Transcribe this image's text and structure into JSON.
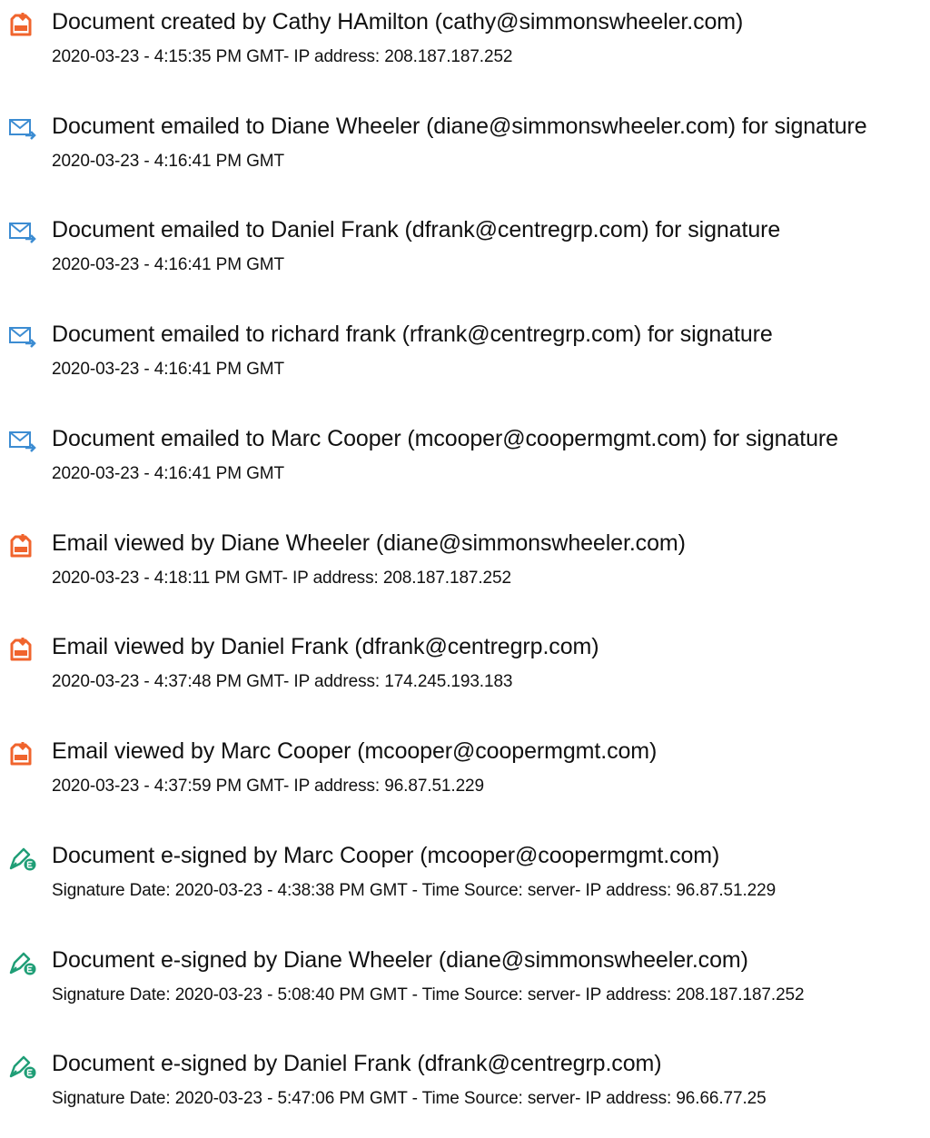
{
  "icon_colors": {
    "doc-orange": "#F0642D",
    "mail-blue": "#3C8CD2",
    "sign-green": "#1F9E76"
  },
  "events": [
    {
      "icon": "document-icon",
      "headline": "Document created by Cathy HAmilton (cathy@simmonswheeler.com)",
      "detail": "2020-03-23 - 4:15:35 PM GMT- IP address: 208.187.187.252"
    },
    {
      "icon": "email-sent-icon",
      "headline": "Document emailed to Diane Wheeler (diane@simmonswheeler.com) for signature",
      "detail": "2020-03-23 - 4:16:41 PM GMT"
    },
    {
      "icon": "email-sent-icon",
      "headline": "Document emailed to Daniel Frank (dfrank@centregrp.com) for signature",
      "detail": "2020-03-23 - 4:16:41 PM GMT"
    },
    {
      "icon": "email-sent-icon",
      "headline": "Document emailed to richard frank (rfrank@centregrp.com) for signature",
      "detail": "2020-03-23 - 4:16:41 PM GMT"
    },
    {
      "icon": "email-sent-icon",
      "headline": "Document emailed to Marc Cooper (mcooper@coopermgmt.com) for signature",
      "detail": "2020-03-23 - 4:16:41 PM GMT"
    },
    {
      "icon": "document-icon",
      "headline": "Email viewed by Diane Wheeler (diane@simmonswheeler.com)",
      "detail": "2020-03-23 - 4:18:11 PM GMT- IP address: 208.187.187.252"
    },
    {
      "icon": "document-icon",
      "headline": "Email viewed by Daniel Frank (dfrank@centregrp.com)",
      "detail": "2020-03-23 - 4:37:48 PM GMT- IP address: 174.245.193.183"
    },
    {
      "icon": "document-icon",
      "headline": "Email viewed by Marc Cooper (mcooper@coopermgmt.com)",
      "detail": "2020-03-23 - 4:37:59 PM GMT- IP address: 96.87.51.229"
    },
    {
      "icon": "e-signature-icon",
      "headline": "Document e-signed by Marc Cooper (mcooper@coopermgmt.com)",
      "detail": "Signature Date: 2020-03-23 - 4:38:38 PM GMT - Time Source: server- IP address: 96.87.51.229"
    },
    {
      "icon": "e-signature-icon",
      "headline": "Document e-signed by Diane Wheeler (diane@simmonswheeler.com)",
      "detail": "Signature Date: 2020-03-23 - 5:08:40 PM GMT - Time Source: server- IP address: 208.187.187.252"
    },
    {
      "icon": "e-signature-icon",
      "headline": "Document e-signed by Daniel Frank (dfrank@centregrp.com)",
      "detail": "Signature Date: 2020-03-23 - 5:47:06 PM GMT - Time Source: server- IP address: 96.66.77.25"
    }
  ]
}
